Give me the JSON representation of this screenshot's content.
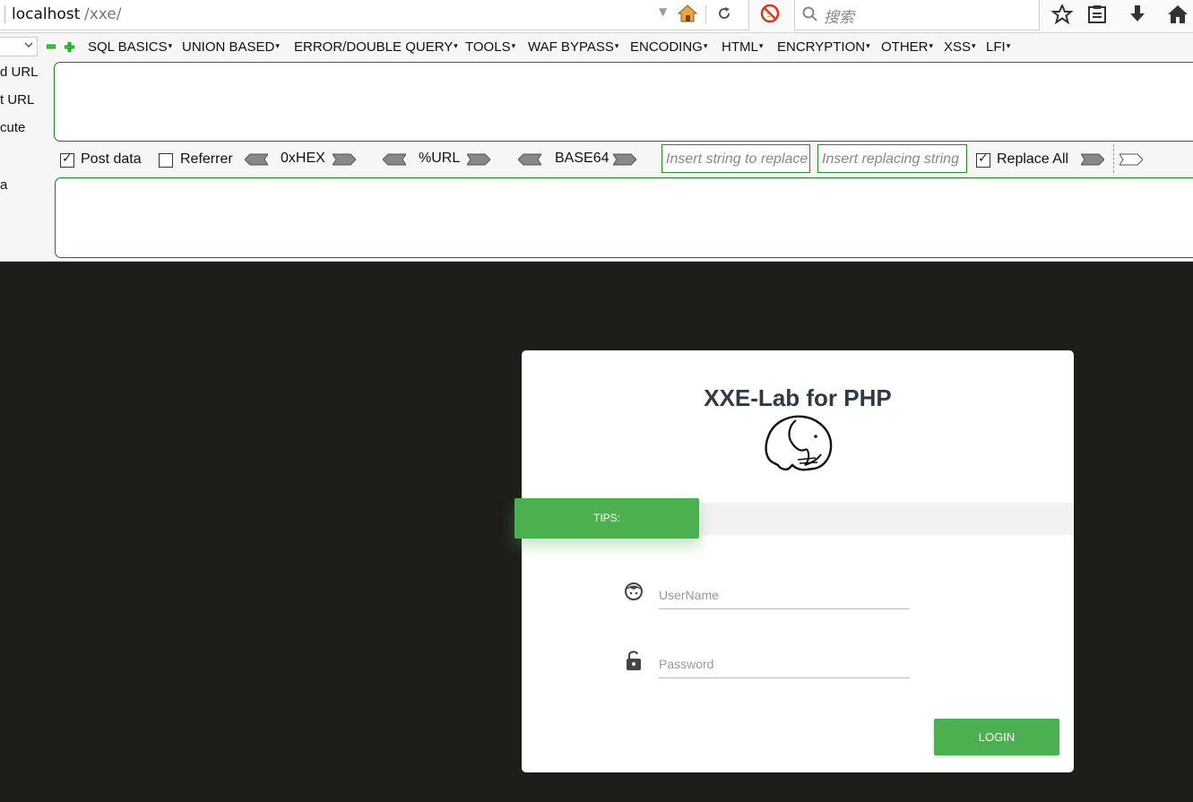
{
  "browser": {
    "url_host": "localhost",
    "url_path": "/xxe/",
    "search_placeholder": "搜索"
  },
  "hackbar": {
    "menu": [
      "SQL BASICS",
      "UNION BASED",
      "ERROR/DOUBLE QUERY",
      "TOOLS",
      "WAF BYPASS",
      "ENCODING",
      "HTML",
      "ENCRYPTION",
      "OTHER",
      "XSS",
      "LFI"
    ],
    "side_labels": {
      "load_url": "d URL",
      "split_url": "t URL",
      "execute": "cute",
      "post_label": "a"
    },
    "options": {
      "post_data": {
        "label": "Post data",
        "checked": true
      },
      "referrer": {
        "label": "Referrer",
        "checked": false
      },
      "hex": "0xHEX",
      "url": "%URL",
      "base64": "BASE64",
      "replace_from_placeholder": "Insert string to replace",
      "replace_to_placeholder": "Insert replacing string",
      "replace_all": {
        "label": "Replace All",
        "checked": true
      }
    }
  },
  "login": {
    "title": "XXE-Lab for PHP",
    "tips": "TIPS:",
    "username_placeholder": "UserName",
    "password_placeholder": "Password",
    "login_button": "LOGIN"
  },
  "colors": {
    "page_bg": "#1d1e1a",
    "accent_green": "#4caf50",
    "title_color": "#2f3a47"
  }
}
